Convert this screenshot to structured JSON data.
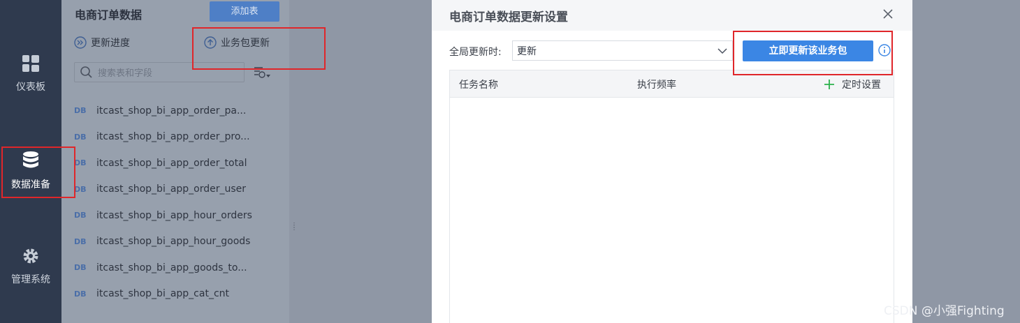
{
  "nav": {
    "items": [
      {
        "label": "仪表板",
        "icon": "dashboard-icon"
      },
      {
        "label": "数据准备",
        "icon": "database-icon"
      },
      {
        "label": "管理系统",
        "icon": "gear-icon"
      }
    ]
  },
  "panel": {
    "title": "电商订单数据",
    "add_button": "添加表",
    "update_progress": "更新进度",
    "package_update": "业务包更新",
    "search_placeholder": "搜索表和字段",
    "tables": [
      "itcast_shop_bi_app_order_pa...",
      "itcast_shop_bi_app_order_pro...",
      "itcast_shop_bi_app_order_total",
      "itcast_shop_bi_app_order_user",
      "itcast_shop_bi_app_hour_orders",
      "itcast_shop_bi_app_hour_goods",
      "itcast_shop_bi_app_goods_to...",
      "itcast_shop_bi_app_cat_cnt"
    ],
    "table_icon_text": "DB"
  },
  "dialog": {
    "title": "电商订单数据更新设置",
    "global_update_label": "全局更新时:",
    "global_update_value": "更新",
    "update_now_button": "立即更新该业务包",
    "columns": [
      "任务名称",
      "执行频率",
      "定时设置"
    ]
  },
  "watermark": "CSDN @小强Fighting",
  "colors": {
    "nav_bg": "#2f3a4e",
    "primary": "#3b86e4",
    "highlight": "#e0262a",
    "add_green": "#2bb24c"
  }
}
